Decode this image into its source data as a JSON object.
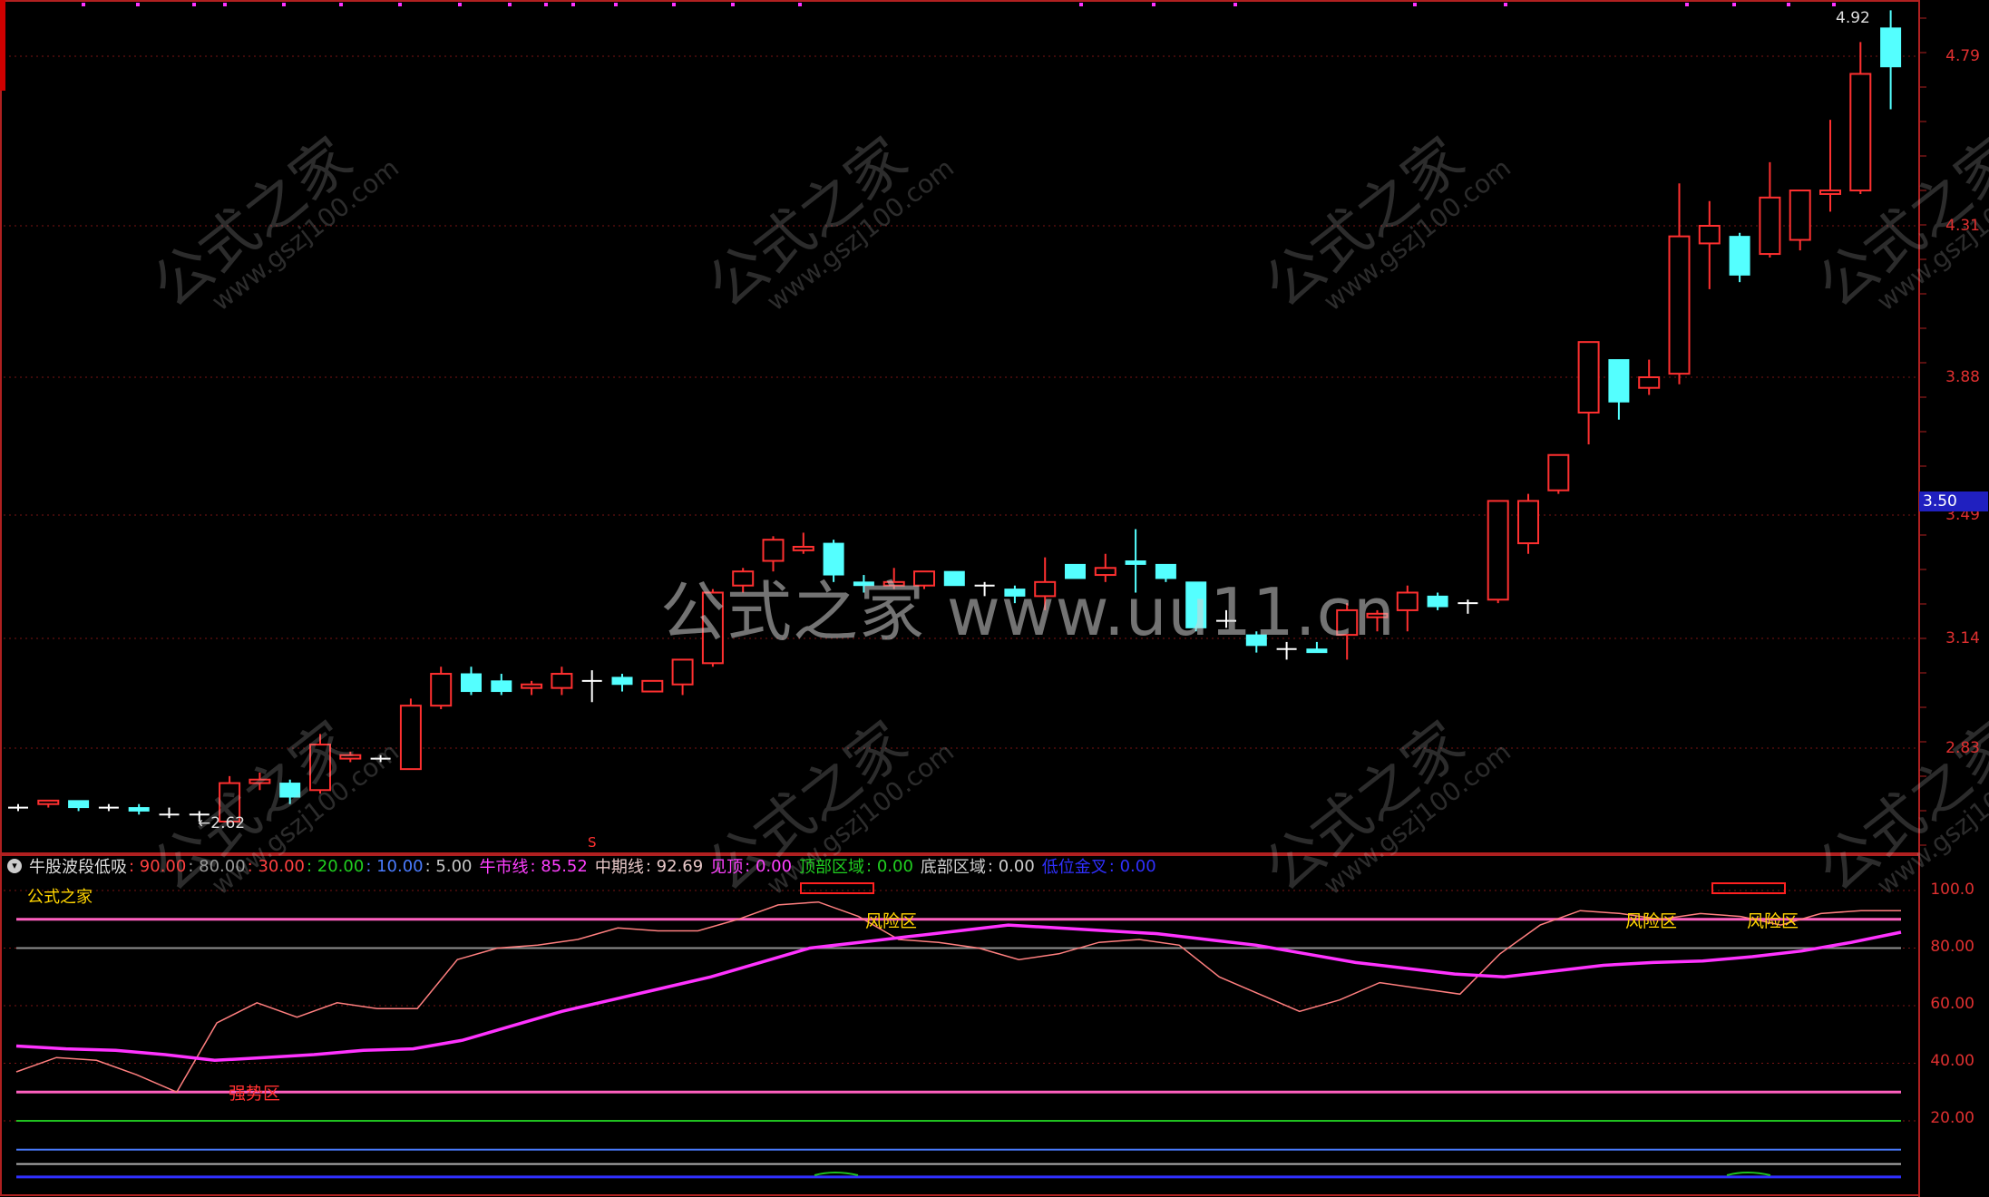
{
  "price_axis": {
    "ticks": [
      "4.79",
      "4.31",
      "3.88",
      "3.49",
      "3.14",
      "2.83"
    ],
    "current_price": "3.50"
  },
  "annotations": {
    "high_label": "4.92",
    "low_label": "2.62",
    "signal_mark": "S"
  },
  "watermark": {
    "center_text": "公式之家 www.uu11.cn",
    "diag_cn": "公式之家",
    "diag_url": "www.gszj100.com"
  },
  "indicator": {
    "name": "牛股波段低吸",
    "params": [
      {
        "text": ": 90.00",
        "color": "#ff4040"
      },
      {
        "text": ": 80.00",
        "color": "#9a9a9a"
      },
      {
        "text": ": 30.00",
        "color": "#ff4040"
      },
      {
        "text": ": 20.00",
        "color": "#20d020"
      },
      {
        "text": ": 10.00",
        "color": "#4a7cff"
      },
      {
        "text": ": 5.00",
        "color": "#c8c8c8"
      }
    ],
    "values": [
      {
        "label": "牛市线",
        "value": ": 85.52",
        "color": "#ff40ff"
      },
      {
        "label": "中期线",
        "value": ": 92.69",
        "color": "#e8c8c8"
      },
      {
        "label": "见顶",
        "value": ": 0.00",
        "color": "#ff40ff"
      },
      {
        "label": "顶部区域",
        "value": ": 0.00",
        "color": "#20d020"
      },
      {
        "label": "底部区域",
        "value": ": 0.00",
        "color": "#d0d0d0"
      },
      {
        "label": "低位金叉",
        "value": ": 0.00",
        "color": "#3030ff"
      }
    ],
    "sub_label": "公式之家",
    "zone_risk": "风险区",
    "zone_strong": "强势区",
    "axis_ticks": [
      "100.0",
      "80.00",
      "60.00",
      "40.00",
      "20.00"
    ]
  },
  "chart_data": {
    "type": "candlestick",
    "colors": {
      "up": "#ff3030",
      "down": "#54ffff",
      "doji": "#ffffff",
      "bull_line": "#ff33ff",
      "mid_line": "#ff7f7f"
    },
    "candles": [
      [
        2.66,
        2.67,
        2.65,
        2.66
      ],
      [
        2.67,
        2.68,
        2.66,
        2.68
      ],
      [
        2.68,
        2.68,
        2.65,
        2.66
      ],
      [
        2.66,
        2.67,
        2.65,
        2.66
      ],
      [
        2.66,
        2.67,
        2.64,
        2.65
      ],
      [
        2.64,
        2.66,
        2.63,
        2.64
      ],
      [
        2.64,
        2.65,
        2.62,
        2.64
      ],
      [
        2.62,
        2.75,
        2.62,
        2.73
      ],
      [
        2.73,
        2.76,
        2.71,
        2.74
      ],
      [
        2.73,
        2.74,
        2.67,
        2.69
      ],
      [
        2.71,
        2.87,
        2.7,
        2.84
      ],
      [
        2.8,
        2.82,
        2.79,
        2.81
      ],
      [
        2.8,
        2.81,
        2.79,
        2.8
      ],
      [
        2.77,
        2.97,
        2.77,
        2.95
      ],
      [
        2.95,
        3.06,
        2.94,
        3.04
      ],
      [
        3.04,
        3.06,
        2.98,
        2.99
      ],
      [
        3.02,
        3.04,
        2.98,
        2.99
      ],
      [
        3.0,
        3.02,
        2.98,
        3.01
      ],
      [
        3.0,
        3.06,
        2.98,
        3.04
      ],
      [
        3.02,
        3.05,
        2.96,
        3.02
      ],
      [
        3.03,
        3.04,
        2.99,
        3.01
      ],
      [
        2.99,
        3.02,
        2.99,
        3.02
      ],
      [
        3.01,
        3.08,
        2.98,
        3.08
      ],
      [
        3.07,
        3.28,
        3.06,
        3.27
      ],
      [
        3.29,
        3.34,
        3.27,
        3.33
      ],
      [
        3.36,
        3.43,
        3.33,
        3.42
      ],
      [
        3.39,
        3.44,
        3.38,
        3.4
      ],
      [
        3.41,
        3.42,
        3.3,
        3.32
      ],
      [
        3.3,
        3.32,
        3.27,
        3.29
      ],
      [
        3.29,
        3.34,
        3.28,
        3.3
      ],
      [
        3.29,
        3.33,
        3.28,
        3.33
      ],
      [
        3.33,
        3.33,
        3.29,
        3.29
      ],
      [
        3.29,
        3.3,
        3.26,
        3.29
      ],
      [
        3.28,
        3.29,
        3.24,
        3.26
      ],
      [
        3.26,
        3.37,
        3.22,
        3.3
      ],
      [
        3.35,
        3.35,
        3.31,
        3.31
      ],
      [
        3.32,
        3.38,
        3.3,
        3.34
      ],
      [
        3.36,
        3.45,
        3.27,
        3.35
      ],
      [
        3.35,
        3.35,
        3.3,
        3.31
      ],
      [
        3.3,
        3.3,
        3.16,
        3.17
      ],
      [
        3.19,
        3.22,
        3.17,
        3.19
      ],
      [
        3.15,
        3.16,
        3.1,
        3.12
      ],
      [
        3.11,
        3.13,
        3.08,
        3.11
      ],
      [
        3.11,
        3.13,
        3.1,
        3.1
      ],
      [
        3.15,
        3.24,
        3.08,
        3.22
      ],
      [
        3.2,
        3.22,
        3.16,
        3.21
      ],
      [
        3.22,
        3.29,
        3.16,
        3.27
      ],
      [
        3.26,
        3.27,
        3.22,
        3.23
      ],
      [
        3.24,
        3.25,
        3.21,
        3.24
      ],
      [
        3.25,
        3.53,
        3.24,
        3.53
      ],
      [
        3.41,
        3.55,
        3.38,
        3.53
      ],
      [
        3.56,
        3.66,
        3.55,
        3.66
      ],
      [
        3.78,
        3.82,
        3.69,
        3.98
      ],
      [
        3.93,
        3.93,
        3.76,
        3.81
      ],
      [
        3.85,
        3.93,
        3.83,
        3.88
      ],
      [
        3.89,
        4.43,
        3.86,
        4.28
      ],
      [
        4.26,
        4.38,
        4.13,
        4.31
      ],
      [
        4.28,
        4.29,
        4.15,
        4.17
      ],
      [
        4.23,
        4.49,
        4.22,
        4.39
      ],
      [
        4.27,
        4.41,
        4.24,
        4.41
      ],
      [
        4.4,
        4.61,
        4.35,
        4.41
      ],
      [
        4.41,
        4.83,
        4.4,
        4.74
      ],
      [
        4.87,
        4.92,
        4.64,
        4.76
      ]
    ],
    "bull_line": [
      46.0,
      45.0,
      44.5,
      43.0,
      41.0,
      42.0,
      43.0,
      44.5,
      45.0,
      48.0,
      53.0,
      58.0,
      62.0,
      66.0,
      70.0,
      75.0,
      80.0,
      82.0,
      84.0,
      86.0,
      88.0,
      87.0,
      86.0,
      85.0,
      83.0,
      81.0,
      78.0,
      75.0,
      73.0,
      71.0,
      70.0,
      72.0,
      74.0,
      75.0,
      75.5,
      77.0,
      79.0,
      82.0,
      85.5
    ],
    "mid_line": [
      37.0,
      42.0,
      41.0,
      36.0,
      30.0,
      54.0,
      61.0,
      56.0,
      61.0,
      59.0,
      59.0,
      76.0,
      80.0,
      81.0,
      83.0,
      87.0,
      86.0,
      86.0,
      90.0,
      95.0,
      96.0,
      91.0,
      83.0,
      82.0,
      80.0,
      76.0,
      78.0,
      82.0,
      83.0,
      81.0,
      70.0,
      64.0,
      58.0,
      62.0,
      68.0,
      66.0,
      64.0,
      78.0,
      88.0,
      93.0,
      92.0,
      90.0,
      92.0,
      91.0,
      88.0,
      92.0,
      93.0,
      93.0
    ]
  }
}
